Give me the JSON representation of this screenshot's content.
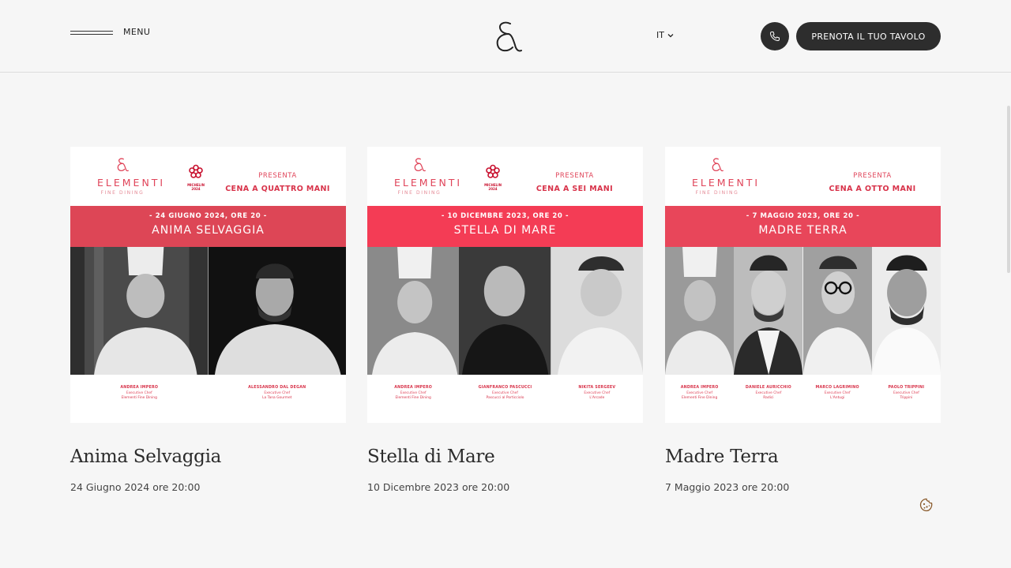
{
  "header": {
    "menu_label": "MENU",
    "lang": "IT",
    "book_label": "PRENOTA IL TUO TAVOLO"
  },
  "icons": {
    "logo": "ampersand-logo",
    "phone": "phone-icon",
    "lang_caret": "chevron-down-icon",
    "cookie": "cookie-icon"
  },
  "colors": {
    "accent": "#e0455a",
    "band_1": "#dd4656",
    "band_2": "#f43c55",
    "band_3": "#e8465a",
    "dark": "#2d2d2d",
    "background": "#f6f6f6"
  },
  "poster_common": {
    "brand": "ELEMENTI",
    "brand_sub": "FINE DINING",
    "michelin": "MICHELIN",
    "michelin_year": "2024",
    "presents": "PRESENTA"
  },
  "events": [
    {
      "title": "Anima Selvaggia",
      "date": "24 Giugno 2024 ore 20:00",
      "poster": {
        "dinner": "CENA A QUATTRO MANI",
        "band_date": "- 24 GIUGNO 2024, ORE 20 -",
        "band_name": "ANIMA SELVAGGIA",
        "chefs": [
          {
            "name": "ANDREA IMPERO",
            "role": "Executive Chef",
            "place": "Elementi Fine Dining"
          },
          {
            "name": "ALESSANDRO DAL DEGAN",
            "role": "Executive Chef",
            "place": "La Tana Gourmet"
          }
        ]
      }
    },
    {
      "title": "Stella di Mare",
      "date": "10 Dicembre 2023 ore 20:00",
      "poster": {
        "dinner": "CENA A SEI MANI",
        "band_date": "- 10 DICEMBRE 2023, ORE 20 -",
        "band_name": "STELLA DI MARE",
        "chefs": [
          {
            "name": "ANDREA IMPERO",
            "role": "Executive Chef",
            "place": "Elementi Fine Dining"
          },
          {
            "name": "GIANFRANCO PASCUCCI",
            "role": "Executive Chef",
            "place": "Pascucci al Porticciolo"
          },
          {
            "name": "NIKITA SERGEEV",
            "role": "Executive Chef",
            "place": "L'Arcade"
          }
        ]
      }
    },
    {
      "title": "Madre Terra",
      "date": "7 Maggio 2023 ore 20:00",
      "poster": {
        "dinner": "CENA A OTTO MANI",
        "band_date": "- 7 MAGGIO 2023, ORE 20 -",
        "band_name": "MADRE TERRA",
        "chefs": [
          {
            "name": "ANDREA IMPERO",
            "role": "Executive Chef",
            "place": "Elementi Fine Dining"
          },
          {
            "name": "DANIELE AURICCHIO",
            "role": "Executive Chef",
            "place": "Radici"
          },
          {
            "name": "MARCO LAGRIMINO",
            "role": "Executive Chef",
            "place": "L'Antugi"
          },
          {
            "name": "PAOLO TRIPPINI",
            "role": "Executive Chef",
            "place": "Trippini"
          }
        ]
      }
    }
  ]
}
